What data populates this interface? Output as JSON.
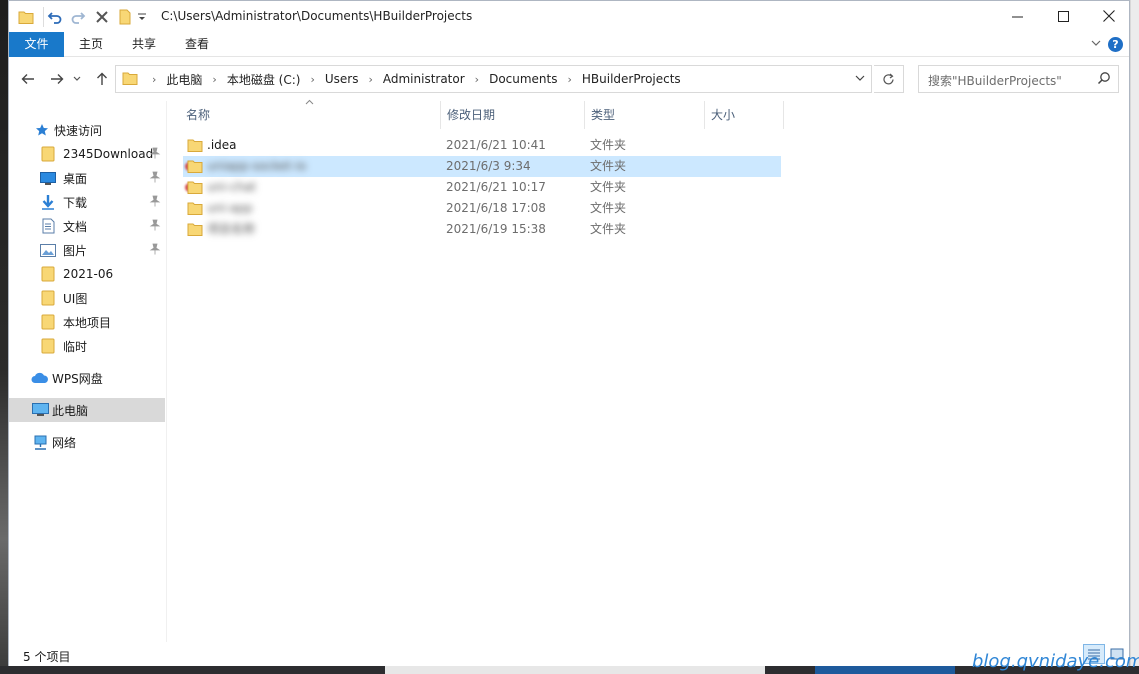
{
  "window": {
    "title_path": "C:\\Users\\Administrator\\Documents\\HBuilderProjects",
    "controls": {
      "minimize": "—",
      "maximize": "☐",
      "close": "✕"
    }
  },
  "ribbon": {
    "tabs": [
      "文件",
      "主页",
      "共享",
      "查看"
    ],
    "help": "?"
  },
  "address": {
    "crumbs": [
      "此电脑",
      "本地磁盘 (C:)",
      "Users",
      "Administrator",
      "Documents",
      "HBuilderProjects"
    ]
  },
  "search": {
    "placeholder": "搜索\"HBuilderProjects\""
  },
  "navpane": {
    "quick_access": "快速访问",
    "items": [
      {
        "label": "2345Download",
        "icon": "folder-icon",
        "pinned": true
      },
      {
        "label": "桌面",
        "icon": "desktop-icon",
        "pinned": true
      },
      {
        "label": "下载",
        "icon": "download-icon",
        "pinned": true
      },
      {
        "label": "文档",
        "icon": "document-icon",
        "pinned": true
      },
      {
        "label": "图片",
        "icon": "picture-icon",
        "pinned": true
      },
      {
        "label": "2021-06",
        "icon": "folder-icon",
        "pinned": false
      },
      {
        "label": "UI图",
        "icon": "folder-icon",
        "pinned": false
      },
      {
        "label": "本地项目",
        "icon": "folder-icon",
        "pinned": false
      },
      {
        "label": "临时",
        "icon": "folder-icon",
        "pinned": false
      }
    ],
    "wps": "WPS网盘",
    "this_pc": "此电脑",
    "network": "网络"
  },
  "columns": {
    "name": "名称",
    "date": "修改日期",
    "type": "类型",
    "size": "大小"
  },
  "files": [
    {
      "name": ".idea",
      "date": "2021/6/21 10:41",
      "type": "文件夹",
      "size": "",
      "blurred": false,
      "highlighted": false
    },
    {
      "name": "uniapp-socket-io",
      "date": "2021/6/3 9:34",
      "type": "文件夹",
      "size": "",
      "blurred": true,
      "highlighted": true
    },
    {
      "name": "uni-chat",
      "date": "2021/6/21 10:17",
      "type": "文件夹",
      "size": "",
      "blurred": true,
      "highlighted": false
    },
    {
      "name": "uni-app",
      "date": "2021/6/18 17:08",
      "type": "文件夹",
      "size": "",
      "blurred": true,
      "highlighted": false
    },
    {
      "name": "项目名称",
      "date": "2021/6/19 15:38",
      "type": "文件夹",
      "size": "",
      "blurred": true,
      "highlighted": false
    }
  ],
  "status": {
    "item_count": "5 个项目"
  },
  "watermark": "blog.qvnidaye.com",
  "colors": {
    "accent": "#1979ca",
    "selection": "#cce8ff",
    "folder": "#f8d775",
    "nav_selected": "#d9d9d9"
  }
}
